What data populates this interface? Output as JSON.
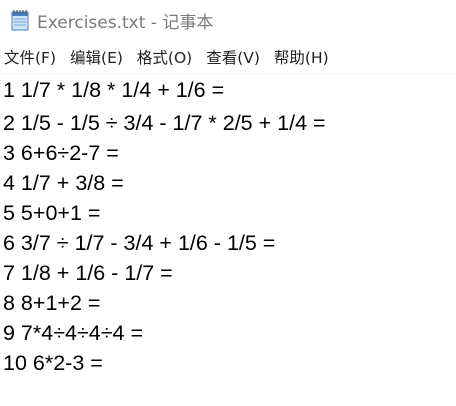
{
  "window": {
    "title": "Exercises.txt - 记事本",
    "icon": "notepad-icon"
  },
  "menu": {
    "items": [
      {
        "label": "文件(F)"
      },
      {
        "label": "编辑(E)"
      },
      {
        "label": "格式(O)"
      },
      {
        "label": "查看(V)"
      },
      {
        "label": "帮助(H)"
      }
    ]
  },
  "editor": {
    "lines": [
      "1 1/7 * 1/8 * 1/4 + 1/6 =",
      "2 1/5 - 1/5 ÷ 3/4 - 1/7 * 2/5 + 1/4 =",
      "3 6+6÷2-7 =",
      "4 1/7 + 3/8 =",
      "5 5+0+1 =",
      "6 3/7 ÷ 1/7 - 3/4 + 1/6 - 1/5 =",
      "7 1/8 + 1/6 - 1/7 =",
      "8 8+1+2 =",
      "9 7*4÷4÷4÷4 =",
      "10 6*2-3 ="
    ]
  },
  "colors": {
    "title_text": "#7a7a7a",
    "background": "#ffffff",
    "icon_blue": "#4a7fc8"
  }
}
